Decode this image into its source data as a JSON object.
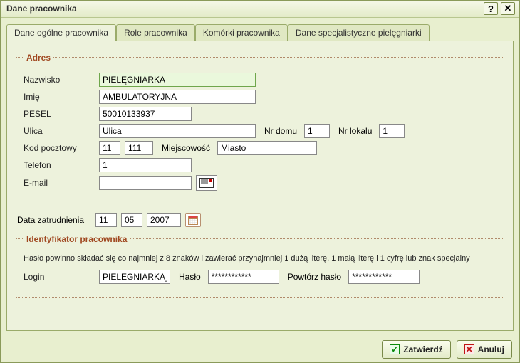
{
  "window": {
    "title": "Dane pracownika",
    "help_label": "?",
    "close_label": "✕"
  },
  "tabs": [
    {
      "label": "Dane ogólne pracownika",
      "active": true
    },
    {
      "label": "Role pracownika",
      "active": false
    },
    {
      "label": "Komórki pracownika",
      "active": false
    },
    {
      "label": "Dane specjalistyczne pielęgniarki",
      "active": false
    }
  ],
  "adres": {
    "legend": "Adres",
    "nazwisko_label": "Nazwisko",
    "nazwisko_value": "PIELĘGNIARKA",
    "imie_label": "Imię",
    "imie_value": "AMBULATORYJNA",
    "pesel_label": "PESEL",
    "pesel_value": "50010133937",
    "ulica_label": "Ulica",
    "ulica_value": "Ulica",
    "nr_domu_label": "Nr domu",
    "nr_domu_value": "1",
    "nr_lokalu_label": "Nr lokalu",
    "nr_lokalu_value": "1",
    "kod_label": "Kod pocztowy",
    "kod1_value": "11",
    "kod2_value": "111",
    "miejscowosc_label": "Miejscowość",
    "miejscowosc_value": "Miasto",
    "telefon_label": "Telefon",
    "telefon_value": "1",
    "email_label": "E-mail",
    "email_value": ""
  },
  "zatrudnienie": {
    "label": "Data zatrudnienia",
    "day": "11",
    "month": "05",
    "year": "2007"
  },
  "ident": {
    "legend": "Identyfikator pracownika",
    "hint": "Hasło powinno składać się co najmniej z 8 znaków i zawierać przynajmniej 1 dużą literę, 1 małą literę i 1 cyfrę lub znak specjalny",
    "login_label": "Login",
    "login_value": "PIELEGNIARKA_",
    "haslo_label": "Hasło",
    "haslo_value": "************",
    "powtorz_label": "Powtórz hasło",
    "powtorz_value": "************"
  },
  "footer": {
    "ok_label": "Zatwierdź",
    "cancel_label": "Anuluj"
  }
}
